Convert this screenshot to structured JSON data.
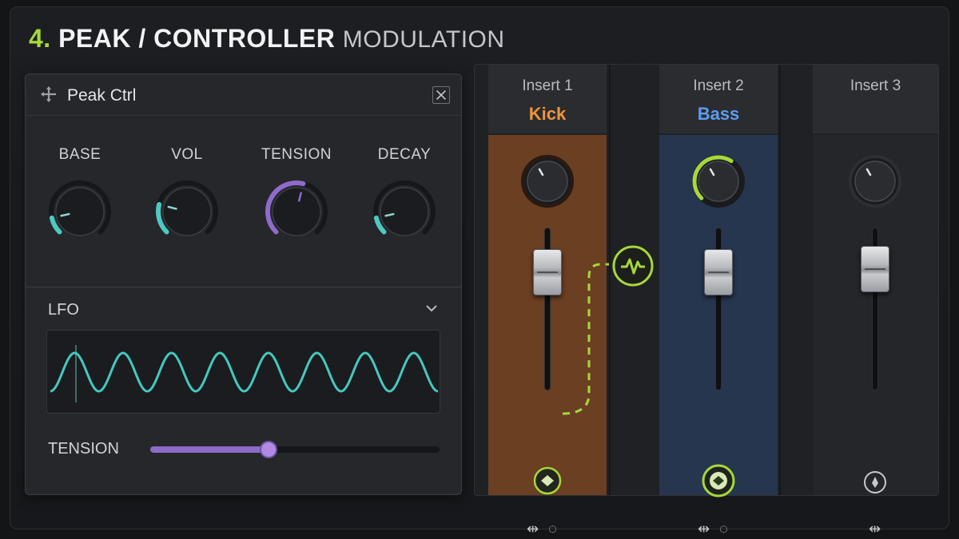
{
  "header": {
    "number": "4.",
    "title": "PEAK / CONTROLLER",
    "subtitle": "MODULATION"
  },
  "panel": {
    "title": "Peak Ctrl",
    "knobs": [
      {
        "label": "BASE",
        "level": 0.12,
        "color": "#4ec9c0"
      },
      {
        "label": "VOL",
        "level": 0.22,
        "color": "#4ec9c0"
      },
      {
        "label": "TENSION",
        "level": 0.55,
        "color": "#8f6bcc"
      },
      {
        "label": "DECAY",
        "level": 0.12,
        "color": "#4ec9c0"
      }
    ],
    "lfo": {
      "label": "LFO",
      "cycles": 8,
      "wave_color": "#45c8bf"
    },
    "tension_slider": {
      "label": "TENSION",
      "value": 0.41,
      "color": "#8d6cc8"
    }
  },
  "mixer": {
    "link_color": "#a6d83a",
    "strips": [
      {
        "insert": "Insert 1",
        "name": "Kick",
        "name_color": "#f0953a",
        "body_color": "#6b3f22",
        "fader_level": 0.78,
        "knob_ring": "#2a1a10",
        "mod": "active"
      },
      {
        "insert": "Insert 2",
        "name": "Bass",
        "name_color": "#5b9df0",
        "body_color": "#26364f",
        "fader_level": 0.78,
        "knob_ring": "#a6d83a",
        "mod": "active"
      },
      {
        "insert": "Insert 3",
        "name": "",
        "name_color": "#ffffff",
        "body_color": "#24262a",
        "fader_level": 0.8,
        "knob_ring": "#2d2f33",
        "mod": "idle"
      }
    ]
  }
}
